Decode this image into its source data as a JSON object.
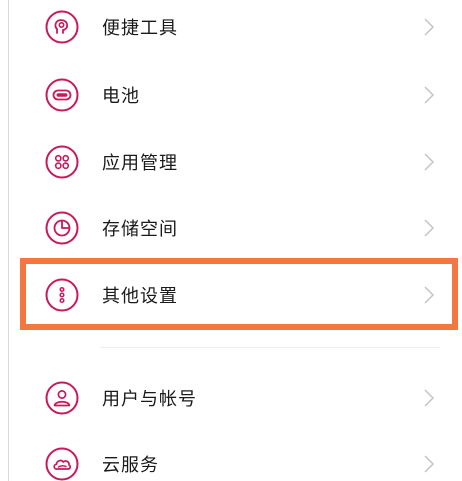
{
  "colors": {
    "icon_accent": "#c8195c",
    "highlight_border": "#f4773f",
    "chevron": "#c4c4c4",
    "text": "#1a1a1a"
  },
  "settings": {
    "items": [
      {
        "label": "便捷工具",
        "icon": "shortcut-tools-icon"
      },
      {
        "label": "电池",
        "icon": "battery-icon"
      },
      {
        "label": "应用管理",
        "icon": "app-management-icon"
      },
      {
        "label": "存储空间",
        "icon": "storage-icon"
      },
      {
        "label": "其他设置",
        "icon": "other-settings-icon",
        "highlighted": true
      },
      {
        "label": "用户与帐号",
        "icon": "user-account-icon"
      },
      {
        "label": "云服务",
        "icon": "cloud-service-icon"
      }
    ]
  }
}
